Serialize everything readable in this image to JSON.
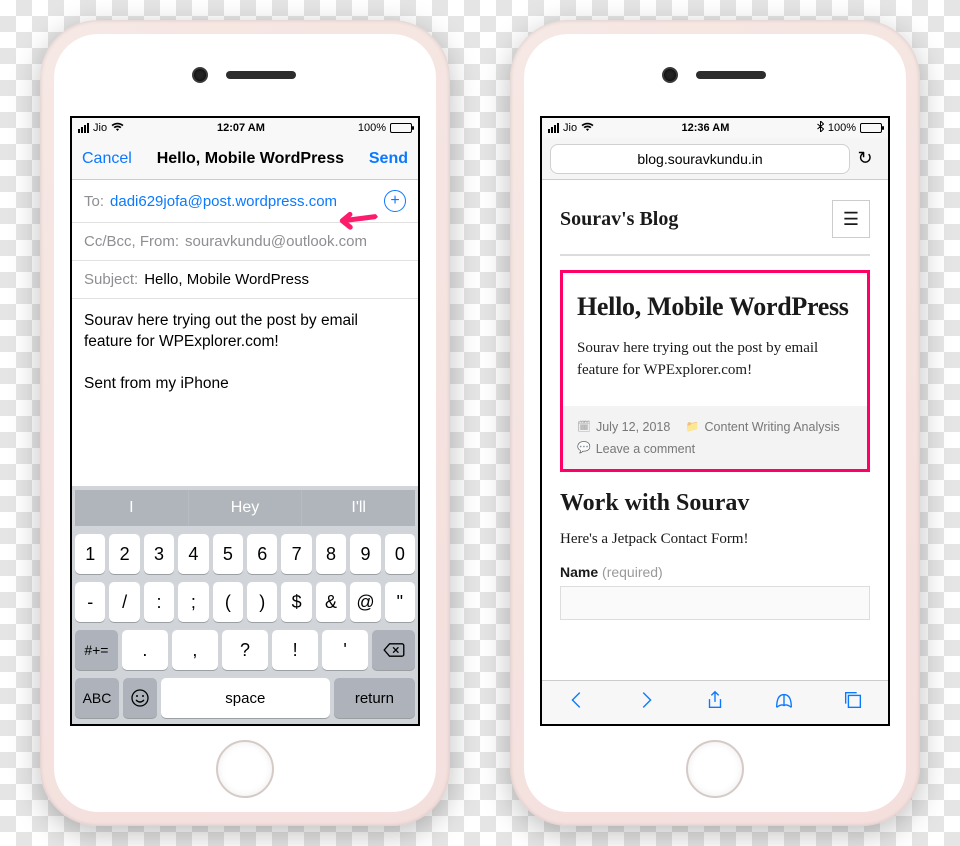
{
  "left_phone": {
    "status": {
      "carrier": "Jio",
      "time": "12:07 AM",
      "battery_pct": "100%"
    },
    "nav": {
      "cancel": "Cancel",
      "title": "Hello, Mobile WordPress",
      "send": "Send"
    },
    "to": {
      "label": "To:",
      "value": "dadi629jofa@post.wordpress.com"
    },
    "ccbcc": {
      "label": "Cc/Bcc, From:",
      "value": "souravkundu@outlook.com"
    },
    "subject": {
      "label": "Subject:",
      "value": "Hello, Mobile WordPress"
    },
    "body_line1": "Sourav here trying out the post by email feature for WPExplorer.com!",
    "body_line2": "Sent from my iPhone",
    "suggestions": [
      "I",
      "Hey",
      "I'll"
    ],
    "num_row": [
      "1",
      "2",
      "3",
      "4",
      "5",
      "6",
      "7",
      "8",
      "9",
      "0"
    ],
    "sym_row": [
      "-",
      "/",
      ":",
      ";",
      "(",
      ")",
      "$",
      "&",
      "@",
      "\""
    ],
    "util_row": {
      "shift": "#+=",
      "keys": [
        ".",
        ",",
        "?",
        "!",
        "'"
      ]
    },
    "bottom_row": {
      "abc": "ABC",
      "space": "space",
      "ret": "return"
    }
  },
  "right_phone": {
    "status": {
      "carrier": "Jio",
      "time": "12:36 AM",
      "battery_pct": "100%"
    },
    "url": "blog.souravkundu.in",
    "blog_title": "Sourav's Blog",
    "post": {
      "title": "Hello, Mobile WordPress",
      "excerpt": "Sourav here trying out the post by email feature for WPExplorer.com!",
      "date": "July 12, 2018",
      "category": "Content Writing Analysis",
      "comment": "Leave a comment"
    },
    "section": {
      "title": "Work with Sourav",
      "text": "Here's a Jetpack Contact Form!",
      "field_label": "Name",
      "field_req": "(required)"
    }
  }
}
